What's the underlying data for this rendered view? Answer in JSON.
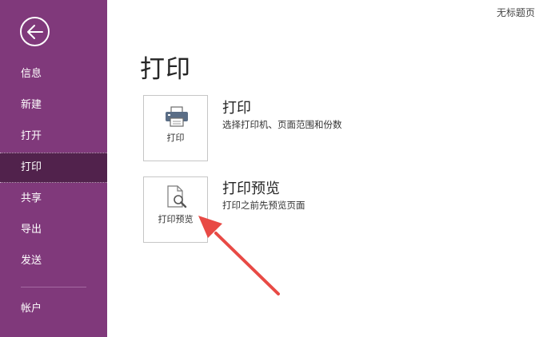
{
  "window": {
    "doc_title": "无标题页"
  },
  "sidebar": {
    "items": [
      {
        "label": "信息"
      },
      {
        "label": "新建"
      },
      {
        "label": "打开"
      },
      {
        "label": "打印"
      },
      {
        "label": "共享"
      },
      {
        "label": "导出"
      },
      {
        "label": "发送"
      },
      {
        "label": "帐户"
      }
    ],
    "active": "打印"
  },
  "main": {
    "title": "打印",
    "options": [
      {
        "tile_label": "打印",
        "title": "打印",
        "description": "选择打印机、页面范围和份数",
        "icon": "printer-icon"
      },
      {
        "tile_label": "打印预览",
        "title": "打印预览",
        "description": "打印之前先预览页面",
        "icon": "print-preview-icon"
      }
    ]
  },
  "colors": {
    "sidebar_bg": "#80397b",
    "sidebar_active": "#51224c",
    "annotation_arrow": "#e84a45"
  }
}
